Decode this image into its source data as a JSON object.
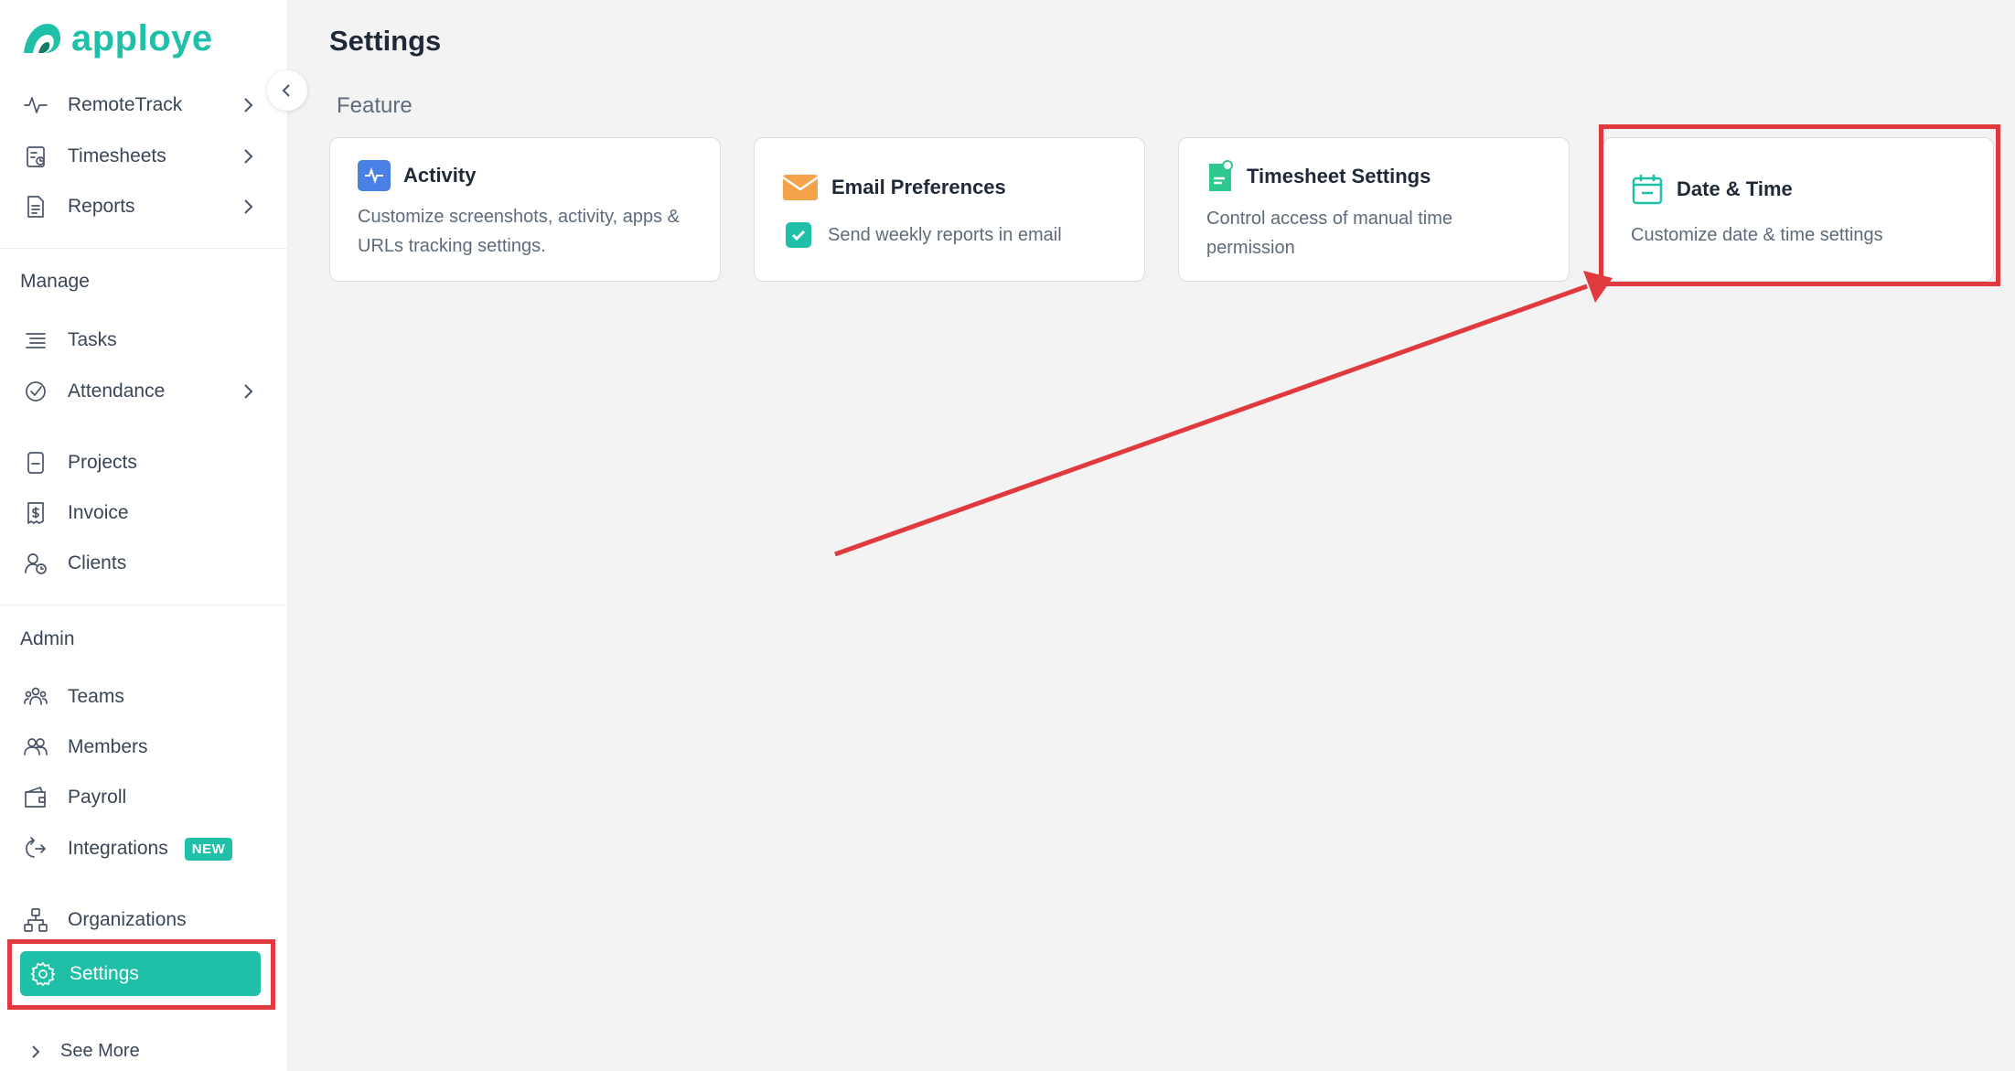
{
  "brand": {
    "name": "apploye",
    "accent": "#1fbfa8"
  },
  "sidebar": {
    "top_items": [
      {
        "label": "RemoteTrack",
        "icon": "pulse-icon"
      },
      {
        "label": "Timesheets",
        "icon": "timesheet-icon"
      },
      {
        "label": "Reports",
        "icon": "report-icon"
      }
    ],
    "manage_label": "Manage",
    "manage_items": [
      {
        "label": "Tasks",
        "icon": "tasks-icon"
      },
      {
        "label": "Attendance",
        "icon": "attendance-icon"
      },
      {
        "label": "Projects",
        "icon": "project-icon"
      },
      {
        "label": "Invoice",
        "icon": "invoice-icon"
      },
      {
        "label": "Clients",
        "icon": "clients-icon"
      }
    ],
    "admin_label": "Admin",
    "admin_items": [
      {
        "label": "Teams",
        "icon": "teams-icon"
      },
      {
        "label": "Members",
        "icon": "members-icon"
      },
      {
        "label": "Payroll",
        "icon": "wallet-icon"
      },
      {
        "label": "Integrations",
        "icon": "integrations-icon",
        "badge": "NEW"
      },
      {
        "label": "Organizations",
        "icon": "organizations-icon"
      },
      {
        "label": "Settings",
        "icon": "gear-icon",
        "active": true
      }
    ],
    "see_more": "See More"
  },
  "main": {
    "title": "Settings",
    "section": "Feature",
    "cards": [
      {
        "title": "Activity",
        "description": "Customize screenshots, activity, apps & URLs tracking settings.",
        "icon": "activity-icon"
      },
      {
        "title": "Email Preferences",
        "checkbox_label": "Send weekly reports in email",
        "checked": true,
        "icon": "envelope-icon"
      },
      {
        "title": "Timesheet Settings",
        "description": "Control access of manual time permission",
        "icon": "timesheet-doc-icon"
      },
      {
        "title": "Date & Time",
        "description": "Customize date & time settings",
        "icon": "calendar-icon"
      }
    ]
  },
  "annotation": {
    "highlight_color": "#e0393e"
  }
}
